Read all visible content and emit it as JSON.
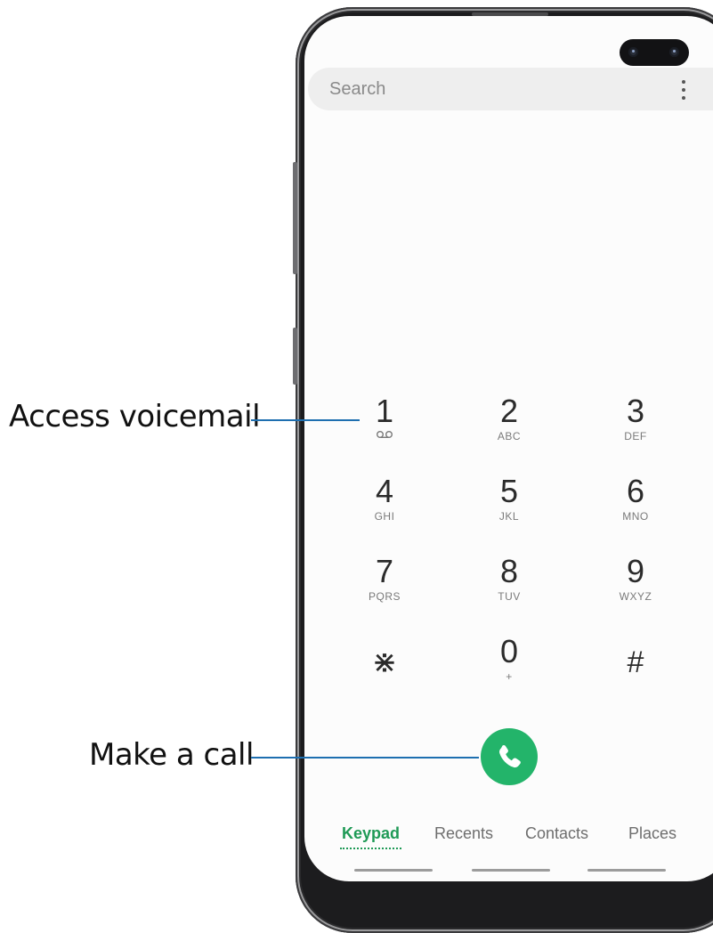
{
  "search": {
    "placeholder": "Search"
  },
  "keypad": [
    {
      "digit": "1",
      "letters": ""
    },
    {
      "digit": "2",
      "letters": "ABC"
    },
    {
      "digit": "3",
      "letters": "DEF"
    },
    {
      "digit": "4",
      "letters": "GHI"
    },
    {
      "digit": "5",
      "letters": "JKL"
    },
    {
      "digit": "6",
      "letters": "MNO"
    },
    {
      "digit": "7",
      "letters": "PQRS"
    },
    {
      "digit": "8",
      "letters": "TUV"
    },
    {
      "digit": "9",
      "letters": "WXYZ"
    },
    {
      "digit": "⋇",
      "letters": ""
    },
    {
      "digit": "0",
      "letters": "+"
    },
    {
      "digit": "#",
      "letters": ""
    }
  ],
  "tabs": [
    {
      "label": "Keypad",
      "active": true
    },
    {
      "label": "Recents",
      "active": false
    },
    {
      "label": "Contacts",
      "active": false
    },
    {
      "label": "Places",
      "active": false
    }
  ],
  "callouts": {
    "voicemail": "Access voicemail",
    "call": "Make a call"
  },
  "colors": {
    "accent": "#23b46a",
    "tab_active": "#1f9a56",
    "leader": "#1e6fb0"
  }
}
